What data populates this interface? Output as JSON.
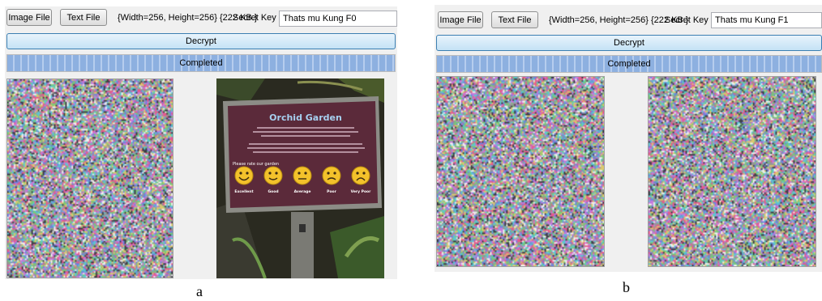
{
  "panels": [
    {
      "image_button": "Image File",
      "text_button": "Text File",
      "image_info": "{Width=256, Height=256} {222 KB.}",
      "secret_key_label": "Secret Key :",
      "secret_key_value": "Thats mu Kung F0",
      "decrypt_button": "Decrypt",
      "progress_label": "Completed",
      "progress_value": 1.0
    },
    {
      "image_button": "Image File",
      "text_button": "Text File",
      "image_info": "{Width=256, Height=256} {222 KB.}",
      "secret_key_label": "Secret Key :",
      "secret_key_value": "Thats mu Kung F1",
      "decrypt_button": "Decrypt",
      "progress_label": "Completed",
      "progress_value": 1.0
    }
  ],
  "photo": {
    "sign_title": "Orchid Garden",
    "sign_prompt": "Please rate our garden",
    "ratings": [
      "Excellent",
      "Good",
      "Average",
      "Poor",
      "Very Poor"
    ]
  },
  "captions": [
    "a",
    "b"
  ],
  "colors": {
    "decrypt_border": "#3c7fb1",
    "progress_fill": "#8db0e0",
    "sign_background": "#5b2a3a"
  }
}
